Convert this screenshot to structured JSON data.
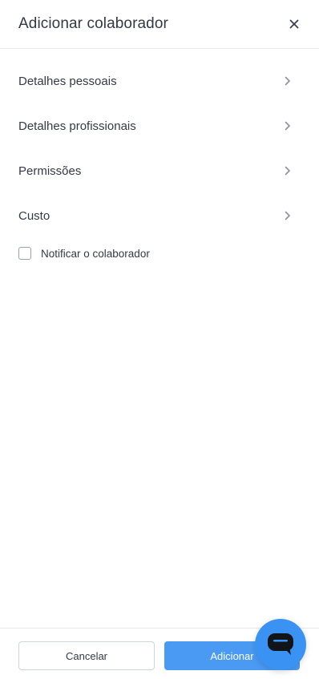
{
  "header": {
    "title": "Adicionar colaborador"
  },
  "sections": [
    {
      "label": "Detalhes pessoais"
    },
    {
      "label": "Detalhes profissionais"
    },
    {
      "label": "Permissões"
    },
    {
      "label": "Custo"
    }
  ],
  "notify": {
    "label": "Notificar o colaborador",
    "checked": false
  },
  "footer": {
    "cancel_label": "Cancelar",
    "add_label": "Adicionar"
  },
  "icons": {
    "close": "close-icon",
    "chevron": "chevron-right-icon",
    "chat": "chat-icon"
  },
  "colors": {
    "accent": "#4a9af4",
    "chat_fab": "#3a93f2",
    "text": "#343946",
    "chevron": "#8a909c",
    "divider": "#e6e8ec"
  }
}
